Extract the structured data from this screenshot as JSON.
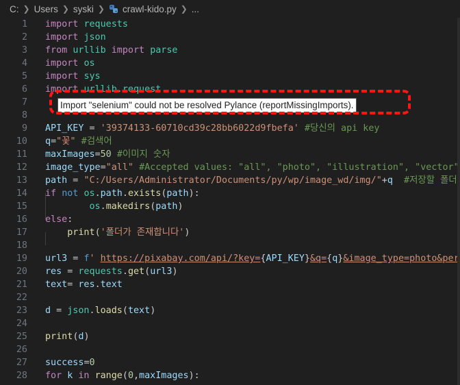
{
  "breadcrumb": {
    "drive": "C:",
    "users": "Users",
    "user": "syski",
    "file": "crawl-kido.py",
    "more": "..."
  },
  "tooltip": "Import \"selenium\" could not be resolved Pylance (reportMissingImports).",
  "colors": {
    "highlight": "#ff1515",
    "background": "#1f1f1f"
  },
  "lines": [
    {
      "n": "1",
      "tokens": [
        [
          "kw2",
          "import"
        ],
        [
          "",
          " "
        ],
        [
          "cls",
          "requests"
        ]
      ]
    },
    {
      "n": "2",
      "tokens": [
        [
          "kw2",
          "import"
        ],
        [
          "",
          " "
        ],
        [
          "cls",
          "json"
        ]
      ]
    },
    {
      "n": "3",
      "tokens": [
        [
          "kw2",
          "from"
        ],
        [
          "",
          " "
        ],
        [
          "cls",
          "urllib"
        ],
        [
          "",
          " "
        ],
        [
          "kw2",
          "import"
        ],
        [
          "",
          " "
        ],
        [
          "cls",
          "parse"
        ]
      ]
    },
    {
      "n": "4",
      "tokens": [
        [
          "kw2",
          "import"
        ],
        [
          "",
          " "
        ],
        [
          "cls",
          "os"
        ]
      ]
    },
    {
      "n": "5",
      "tokens": [
        [
          "kw2",
          "import"
        ],
        [
          "",
          " "
        ],
        [
          "cls",
          "sys"
        ]
      ]
    },
    {
      "n": "6",
      "tokens": [
        [
          "kw2",
          "import"
        ],
        [
          "",
          " "
        ],
        [
          "cls",
          "urllib.request"
        ]
      ]
    },
    {
      "n": "7",
      "tokens": []
    },
    {
      "n": "8",
      "tokens": []
    },
    {
      "n": "9",
      "tokens": [
        [
          "var",
          "API_KEY"
        ],
        [
          "",
          " = "
        ],
        [
          "str",
          "'39374133-60710cd39c28bb6022d9fbefa'"
        ],
        [
          "",
          " "
        ],
        [
          "com",
          "#당신의 api key"
        ]
      ]
    },
    {
      "n": "10",
      "tokens": [
        [
          "var",
          "q"
        ],
        [
          "",
          "="
        ],
        [
          "str",
          "\"꽃\""
        ],
        [
          "",
          " "
        ],
        [
          "com",
          "#검색어"
        ]
      ]
    },
    {
      "n": "11",
      "tokens": [
        [
          "var",
          "maxImages"
        ],
        [
          "",
          "="
        ],
        [
          "num",
          "50"
        ],
        [
          "",
          " "
        ],
        [
          "com",
          "#이미지 숫자"
        ]
      ]
    },
    {
      "n": "12",
      "tokens": [
        [
          "var",
          "image_type"
        ],
        [
          "",
          "="
        ],
        [
          "str",
          "\"all\""
        ],
        [
          "",
          " "
        ],
        [
          "com",
          "#Accepted values: \"all\", \"photo\", \"illustration\", \"vector\""
        ]
      ]
    },
    {
      "n": "13",
      "tokens": [
        [
          "var",
          "path"
        ],
        [
          "",
          " = "
        ],
        [
          "str",
          "\"C:/Users/Administrator/Documents/py/wp/image_wd/img/\""
        ],
        [
          "",
          "+"
        ],
        [
          "var",
          "q"
        ],
        [
          "",
          "  "
        ],
        [
          "com",
          "#저장할 폴더"
        ]
      ]
    },
    {
      "n": "14",
      "tokens": [
        [
          "kw2",
          "if"
        ],
        [
          "",
          " "
        ],
        [
          "kw",
          "not"
        ],
        [
          "",
          " "
        ],
        [
          "cls",
          "os"
        ],
        [
          "",
          "."
        ],
        [
          "var",
          "path"
        ],
        [
          "",
          "."
        ],
        [
          "fn",
          "exists"
        ],
        [
          "",
          "("
        ],
        [
          "var",
          "path"
        ],
        [
          "",
          "):"
        ]
      ]
    },
    {
      "n": "15",
      "tokens": [
        [
          "",
          "        "
        ],
        [
          "cls",
          "os"
        ],
        [
          "",
          "."
        ],
        [
          "fn",
          "makedirs"
        ],
        [
          "",
          "("
        ],
        [
          "var",
          "path"
        ],
        [
          "",
          ")"
        ]
      ]
    },
    {
      "n": "16",
      "tokens": [
        [
          "kw2",
          "else"
        ],
        [
          "",
          ":"
        ]
      ]
    },
    {
      "n": "17",
      "tokens": [
        [
          "",
          "    "
        ],
        [
          "fn",
          "print"
        ],
        [
          "",
          "("
        ],
        [
          "str",
          "'폴더가 존재합니다'"
        ],
        [
          "",
          ")"
        ]
      ]
    },
    {
      "n": "18",
      "tokens": []
    },
    {
      "n": "19",
      "tokens": [
        [
          "var",
          "url3"
        ],
        [
          "",
          " = "
        ],
        [
          "kw",
          "f"
        ],
        [
          "str",
          "' "
        ],
        [
          "url",
          "https://pixabay.com/api/?key="
        ],
        [
          "",
          "{"
        ],
        [
          "interp",
          "API_KEY"
        ],
        [
          "",
          "}"
        ],
        [
          "url",
          "&q="
        ],
        [
          "",
          "{"
        ],
        [
          "interp",
          "q"
        ],
        [
          "",
          "}"
        ],
        [
          "url",
          "&image_type=photo&per_pag"
        ]
      ]
    },
    {
      "n": "20",
      "tokens": [
        [
          "var",
          "res"
        ],
        [
          "",
          " = "
        ],
        [
          "cls",
          "requests"
        ],
        [
          "",
          "."
        ],
        [
          "fn",
          "get"
        ],
        [
          "",
          "("
        ],
        [
          "var",
          "url3"
        ],
        [
          "",
          ")"
        ]
      ]
    },
    {
      "n": "21",
      "tokens": [
        [
          "var",
          "text"
        ],
        [
          "",
          "= "
        ],
        [
          "var",
          "res"
        ],
        [
          "",
          "."
        ],
        [
          "var",
          "text"
        ]
      ]
    },
    {
      "n": "22",
      "tokens": []
    },
    {
      "n": "23",
      "tokens": [
        [
          "var",
          "d"
        ],
        [
          "",
          " = "
        ],
        [
          "cls",
          "json"
        ],
        [
          "",
          "."
        ],
        [
          "fn",
          "loads"
        ],
        [
          "",
          "("
        ],
        [
          "var",
          "text"
        ],
        [
          "",
          ")"
        ]
      ]
    },
    {
      "n": "24",
      "tokens": []
    },
    {
      "n": "25",
      "tokens": [
        [
          "fn",
          "print"
        ],
        [
          "",
          "("
        ],
        [
          "var",
          "d"
        ],
        [
          "",
          ")"
        ]
      ]
    },
    {
      "n": "26",
      "tokens": []
    },
    {
      "n": "27",
      "tokens": [
        [
          "var",
          "success"
        ],
        [
          "",
          "="
        ],
        [
          "num",
          "0"
        ]
      ]
    },
    {
      "n": "28",
      "tokens": [
        [
          "kw2",
          "for"
        ],
        [
          "",
          " "
        ],
        [
          "var",
          "k"
        ],
        [
          "",
          " "
        ],
        [
          "kw2",
          "in"
        ],
        [
          "",
          " "
        ],
        [
          "fn",
          "range"
        ],
        [
          "",
          "("
        ],
        [
          "num",
          "0"
        ],
        [
          "",
          ","
        ],
        [
          "var",
          "maxImages"
        ],
        [
          "",
          "):"
        ]
      ]
    }
  ]
}
